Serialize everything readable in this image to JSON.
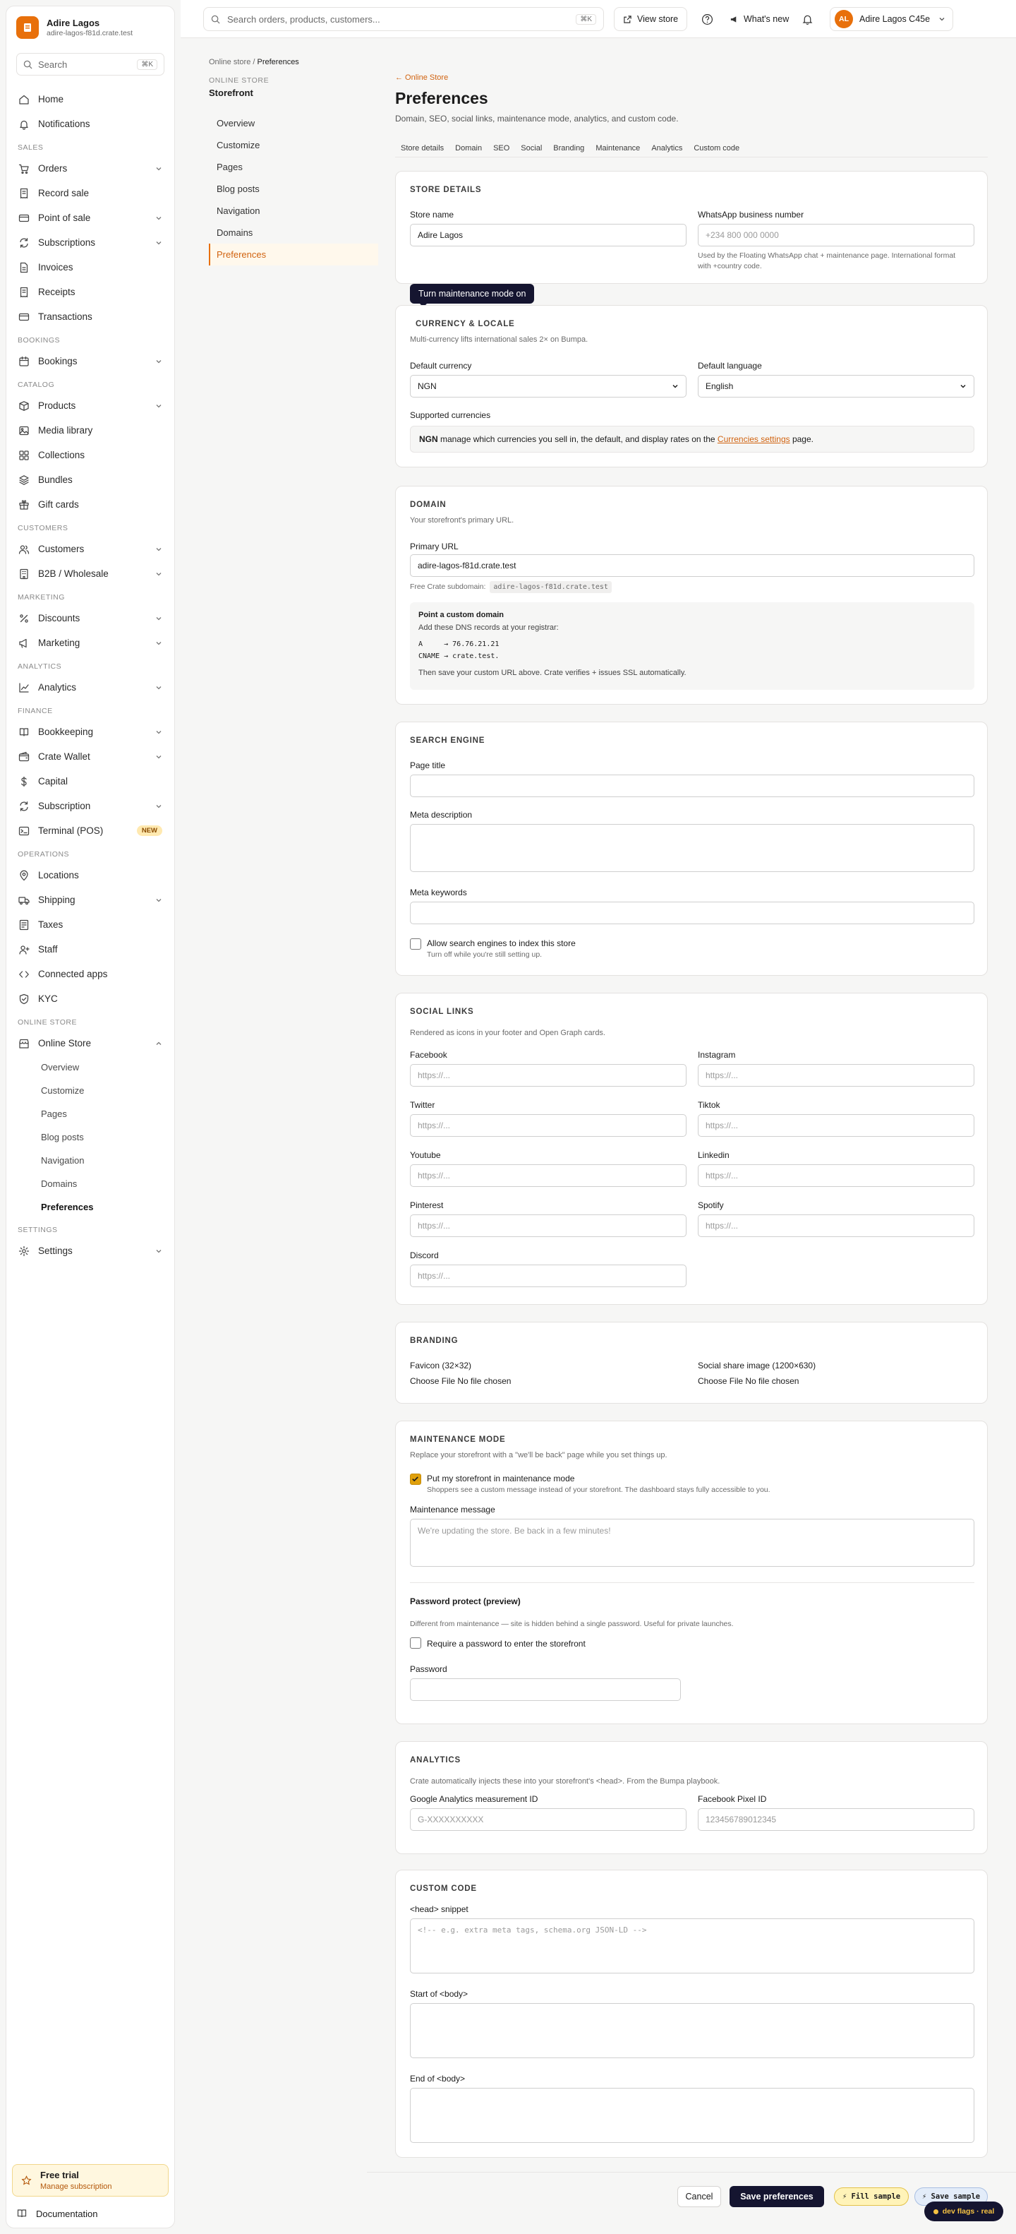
{
  "sidebar": {
    "brand_name": "Adire Lagos",
    "brand_sub": "adire-lagos-f81d.crate.test",
    "search_label": "Search",
    "search_kbd": "⌘K",
    "items": [
      {
        "label": "Home"
      },
      {
        "label": "Notifications"
      },
      {
        "section": "SALES"
      },
      {
        "label": "Orders"
      },
      {
        "label": "Record sale"
      },
      {
        "label": "Point of sale"
      },
      {
        "label": "Subscriptions"
      },
      {
        "label": "Invoices"
      },
      {
        "label": "Receipts"
      },
      {
        "label": "Transactions"
      },
      {
        "section": "BOOKINGS"
      },
      {
        "label": "Bookings"
      },
      {
        "section": "CATALOG"
      },
      {
        "label": "Products"
      },
      {
        "label": "Media library"
      },
      {
        "label": "Collections"
      },
      {
        "label": "Bundles"
      },
      {
        "label": "Gift cards"
      },
      {
        "section": "CUSTOMERS"
      },
      {
        "label": "Customers"
      },
      {
        "label": "B2B / Wholesale"
      },
      {
        "section": "MARKETING"
      },
      {
        "label": "Discounts"
      },
      {
        "label": "Marketing"
      },
      {
        "section": "ANALYTICS"
      },
      {
        "label": "Analytics"
      },
      {
        "section": "FINANCE"
      },
      {
        "label": "Bookkeeping"
      },
      {
        "label": "Crate Wallet"
      },
      {
        "label": "Capital"
      },
      {
        "label": "Subscription"
      },
      {
        "label": "Terminal (POS)",
        "badge": "NEW"
      },
      {
        "section": "OPERATIONS"
      },
      {
        "label": "Locations"
      },
      {
        "label": "Shipping"
      },
      {
        "label": "Taxes"
      },
      {
        "label": "Staff"
      },
      {
        "label": "Connected apps"
      },
      {
        "label": "KYC"
      },
      {
        "section": "ONLINE STORE"
      },
      {
        "label": "Online Store"
      },
      {
        "sub": "Overview"
      },
      {
        "sub": "Customize"
      },
      {
        "sub": "Pages"
      },
      {
        "sub": "Blog posts"
      },
      {
        "sub": "Navigation"
      },
      {
        "sub": "Domains"
      },
      {
        "sub": "Preferences"
      },
      {
        "section": "SETTINGS"
      },
      {
        "label": "Settings"
      }
    ],
    "trial_title": "Free trial",
    "trial_link": "Manage subscription",
    "documentation": "Documentation"
  },
  "topbar": {
    "search_placeholder": "Search orders, products, customers...",
    "search_kbd": "⌘K",
    "view_store": "View store",
    "whats_new": "What's new",
    "avatar_initials": "AL",
    "user_name": "Adire Lagos C45e"
  },
  "breadcrumb": {
    "parent": "Online store",
    "sep": "/",
    "current": "Preferences"
  },
  "online_store_nav": {
    "eyebrow": "ONLINE STORE",
    "title": "Storefront",
    "items": [
      "Overview",
      "Customize",
      "Pages",
      "Blog posts",
      "Navigation",
      "Domains",
      "Preferences"
    ]
  },
  "header": {
    "back": "← Online Store",
    "title": "Preferences",
    "description": "Domain, SEO, social links, maintenance mode, analytics, and custom code.",
    "tabs": [
      "Store details",
      "Domain",
      "SEO",
      "Social",
      "Branding",
      "Maintenance",
      "Analytics",
      "Custom code"
    ]
  },
  "tooltip": "Turn maintenance mode on",
  "store_details": {
    "title": "STORE DETAILS",
    "store_name_label": "Store name",
    "store_name_value": "Adire Lagos",
    "whatsapp_label": "WhatsApp business number",
    "whatsapp_placeholder": "+234 800 000 0000",
    "whatsapp_hint": "Used by the Floating WhatsApp chat + maintenance page. International format with +country code."
  },
  "currency": {
    "title": "CURRENCY & LOCALE",
    "subtitle": "Multi-currency lifts international sales 2× on Bumpa.",
    "currency_label": "Default currency",
    "currency_value": "NGN",
    "language_label": "Default language",
    "language_value": "English",
    "supported_label": "Supported currencies",
    "supported_code": "NGN",
    "supported_text_a": " manage which currencies you sell in, the default, and display rates on the ",
    "supported_link": "Currencies settings",
    "supported_text_b": " page."
  },
  "domain": {
    "title": "DOMAIN",
    "subtitle": "Your storefront's primary URL.",
    "primary_label": "Primary URL",
    "primary_value": "adire-lagos-f81d.crate.test",
    "free_label": "Free Crate subdomain:",
    "free_value": "adire-lagos-f81d.crate.test",
    "box_title": "Point a custom domain",
    "box_sub": "Add these DNS records at your registrar:",
    "record_a": "A     → 76.76.21.21",
    "record_cname": "CNAME → crate.test.",
    "box_footer": "Then save your custom URL above. Crate verifies + issues SSL automatically."
  },
  "seo": {
    "title": "SEARCH ENGINE",
    "page_title_label": "Page title",
    "meta_desc_label": "Meta description",
    "meta_kw_label": "Meta keywords",
    "index_label": "Allow search engines to index this store",
    "index_hint": "Turn off while you're still setting up."
  },
  "social": {
    "title": "SOCIAL LINKS",
    "subtitle": "Rendered as icons in your footer and Open Graph cards.",
    "placeholder": "https://...",
    "fields": [
      "Facebook",
      "Instagram",
      "Twitter",
      "Tiktok",
      "Youtube",
      "Linkedin",
      "Pinterest",
      "Spotify",
      "Discord"
    ]
  },
  "branding": {
    "title": "BRANDING",
    "favicon_label": "Favicon (32×32)",
    "share_label": "Social share image (1200×630)",
    "choose": "Choose File",
    "nofile": "No file chosen"
  },
  "maintenance": {
    "title": "MAINTENANCE MODE",
    "subtitle": "Replace your storefront with a \"we'll be back\" page while you set things up.",
    "toggle_label": "Put my storefront in maintenance mode",
    "toggle_hint": "Shoppers see a custom message instead of your storefront. The dashboard stays fully accessible to you.",
    "message_label": "Maintenance message",
    "message_placeholder": "We're updating the store. Be back in a few minutes!",
    "pw_title": "Password protect (preview)",
    "pw_desc": "Different from maintenance — site is hidden behind a single password. Useful for private launches.",
    "pw_toggle": "Require a password to enter the storefront",
    "pw_label": "Password"
  },
  "analytics": {
    "title": "ANALYTICS",
    "subtitle": "Crate automatically injects these into your storefront's <head>. From the Bumpa playbook.",
    "ga_label": "Google Analytics measurement ID",
    "ga_placeholder": "G-XXXXXXXXXX",
    "fb_label": "Facebook Pixel ID",
    "fb_placeholder": "123456789012345"
  },
  "custom_code": {
    "title": "CUSTOM CODE",
    "head_label": "<head> snippet",
    "head_placeholder": "<!-- e.g. extra meta tags, schema.org JSON-LD -->",
    "body_start_label": "Start of <body>",
    "body_end_label": "End of <body>"
  },
  "footer": {
    "cancel": "Cancel",
    "save": "Save preferences",
    "fill_sample": "⚡ Fill sample",
    "save_sample": "⚡ Save sample",
    "dev_flags": "dev flags · real"
  },
  "colors": {
    "accent": "#e8700b",
    "link": "#d16310",
    "dark": "#151530",
    "checkbox_on": "#e0a00b"
  }
}
